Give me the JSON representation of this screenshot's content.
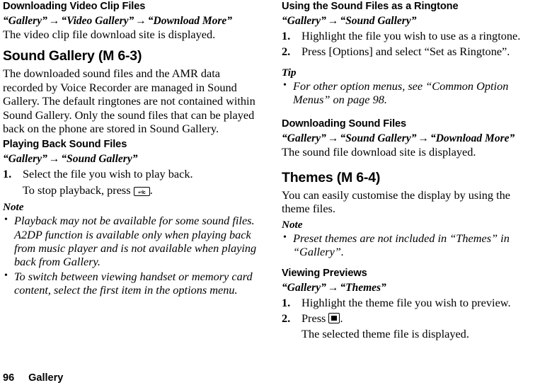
{
  "page": {
    "footer": {
      "page_number": "96",
      "section": "Gallery"
    }
  },
  "left_column": {
    "video_clip": {
      "heading": "Downloading Video Clip Files",
      "nav_path": {
        "step1": "“Gallery”",
        "arrow1": "→",
        "step2": "“Video Gallery”",
        "arrow2": "→",
        "step3": "“Download More”"
      },
      "body": "The video clip file download site is displayed."
    },
    "sound_gallery": {
      "heading": "Sound Gallery (M 6-3)",
      "body": "The downloaded sound files and the AMR data recorded by Voice Recorder are managed in Sound Gallery. The default ringtones are not contained within Sound Gallery. Only the sound files that can be played back on the phone are stored in Sound Gallery."
    },
    "playing_back": {
      "heading": "Playing Back Sound Files",
      "nav_path": {
        "step1": "“Gallery”",
        "arrow1": "→",
        "step2": "“Sound Gallery”"
      },
      "steps": [
        {
          "num": "1.",
          "text": "Select the file you wish to play back."
        }
      ],
      "stop_playback_prefix": "To stop playback, press",
      "stop_playback_key_glyph": "clear-key-icon",
      "stop_playback_key_label": "↵/c",
      "stop_playback_suffix": "."
    },
    "note": {
      "label": "Note",
      "bullets": [
        "Playback may not be available for some sound files. A2DP function is available only when playing back from music player and is not available when playing back from Gallery.",
        "To switch between viewing handset or memory card content, select the first item in the options menu."
      ]
    }
  },
  "right_column": {
    "ringtone": {
      "heading": "Using the Sound Files as a Ringtone",
      "nav_path": {
        "step1": "“Gallery”",
        "arrow1": "→",
        "step2": "“Sound Gallery”"
      },
      "steps": [
        {
          "num": "1.",
          "text": "Highlight the file you wish to use as a ringtone."
        },
        {
          "num": "2.",
          "text": "Press [Options] and select “Set as Ringtone”."
        }
      ]
    },
    "tip": {
      "label": "Tip",
      "bullets": [
        "For other option menus, see “Common Option Menus” on page 98."
      ]
    },
    "downloading_sound": {
      "heading": "Downloading Sound Files",
      "nav_path": {
        "step1": "“Gallery”",
        "arrow1": "→",
        "step2": "“Sound Gallery”",
        "arrow2": "→",
        "step3": "“Download More”"
      },
      "body": "The sound file download site is displayed."
    },
    "themes": {
      "heading": "Themes (M 6-4)",
      "body": "You can easily customise the display by using the theme files."
    },
    "themes_note": {
      "label": "Note",
      "bullets": [
        "Preset themes are not included in “Themes” in “Gallery”."
      ]
    },
    "viewing_previews": {
      "heading": "Viewing Previews",
      "nav_path": {
        "step1": "“Gallery”",
        "arrow1": "→",
        "step2": "“Themes”"
      },
      "steps": [
        {
          "num": "1.",
          "text": "Highlight the theme file you wish to preview."
        }
      ],
      "press_num": "2.",
      "press_prefix": "Press",
      "press_key_glyph": "center-select-key-icon",
      "press_suffix": ".",
      "result_text": "The selected theme file is displayed."
    }
  }
}
